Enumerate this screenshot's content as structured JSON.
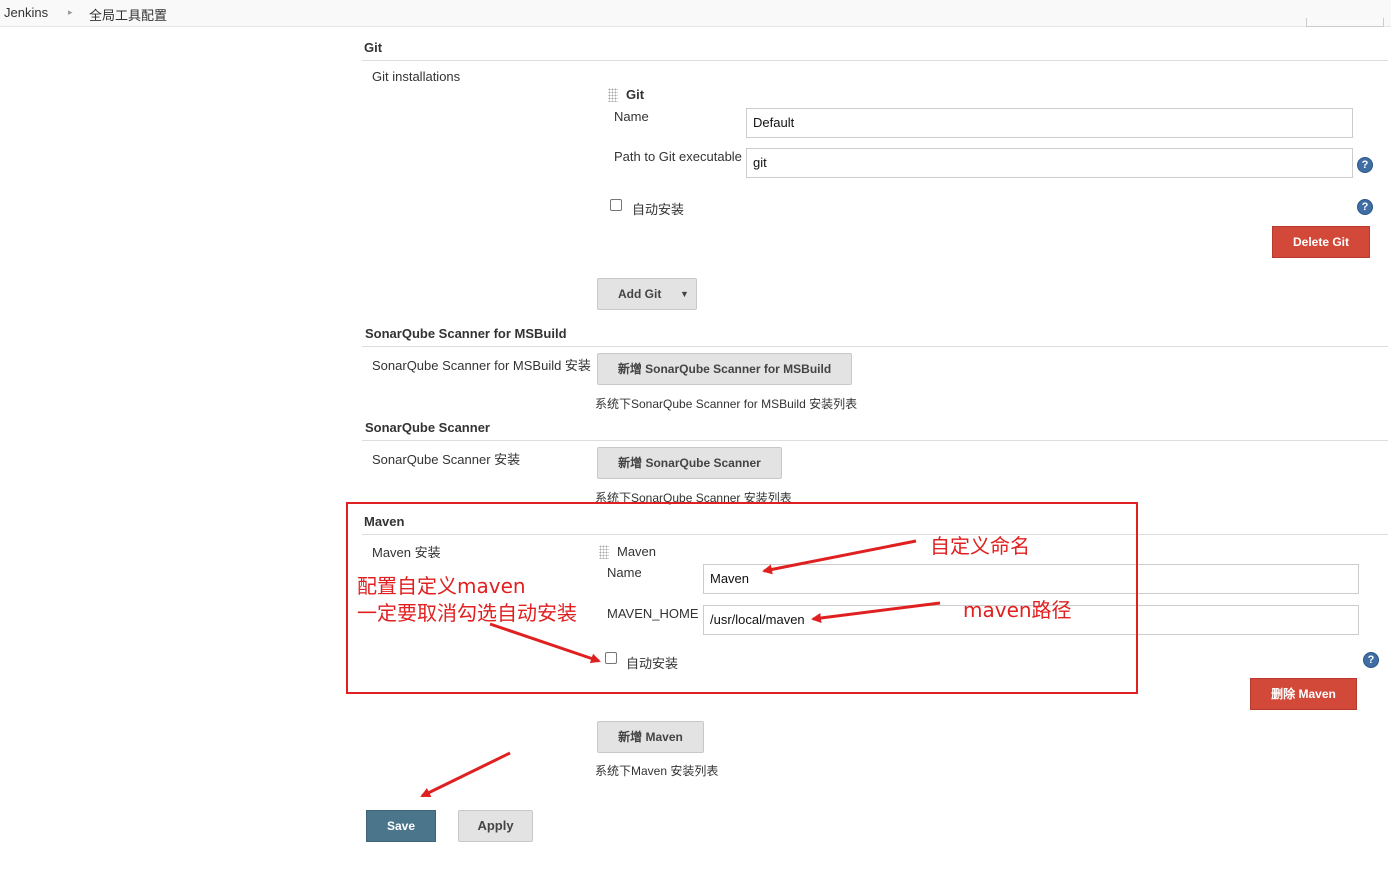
{
  "breadcrumb": {
    "home": "Jenkins",
    "page": "全局工具配置"
  },
  "git": {
    "section_title": "Git",
    "installations_label": "Git installations",
    "item_header": "Git",
    "name_label": "Name",
    "name_value": "Default",
    "path_label": "Path to Git executable",
    "path_value": "git",
    "auto_install_label": "自动安装",
    "auto_install_checked": false,
    "delete_button": "Delete Git",
    "add_button": "Add Git"
  },
  "sonar_msbuild": {
    "section_title": "SonarQube Scanner for MSBuild",
    "installations_label": "SonarQube Scanner for MSBuild 安装",
    "add_button": "新增 SonarQube Scanner for MSBuild",
    "list_caption": "系统下SonarQube Scanner for MSBuild 安装列表"
  },
  "sonar_scanner": {
    "section_title": "SonarQube Scanner",
    "installations_label": "SonarQube Scanner 安装",
    "add_button": "新增 SonarQube Scanner",
    "list_caption": "系统下SonarQube Scanner 安装列表"
  },
  "maven": {
    "section_title": "Maven",
    "installations_label": "Maven 安装",
    "item_header": "Maven",
    "name_label": "Name",
    "name_value": "Maven",
    "home_label": "MAVEN_HOME",
    "home_value": "/usr/local/maven",
    "auto_install_label": "自动安装",
    "auto_install_checked": false,
    "delete_button": "删除 Maven",
    "add_button": "新增 Maven",
    "list_caption": "系统下Maven 安装列表"
  },
  "actions": {
    "save": "Save",
    "apply": "Apply"
  },
  "annotations": {
    "custom_name": "自定义命名",
    "maven_path": "maven路径",
    "note_line1": "配置自定义maven",
    "note_line2": "一定要取消勾选自动安装",
    "color": "#e02020"
  },
  "colors": {
    "delete_red": "#d24939",
    "save_blue": "#4b758b",
    "help_blue": "#3e6ea4"
  },
  "icons": {
    "help": "question-mark",
    "drag": "grip-dots",
    "dropdown": "caret-down",
    "breadcrumb_sep": "triangle-right"
  }
}
